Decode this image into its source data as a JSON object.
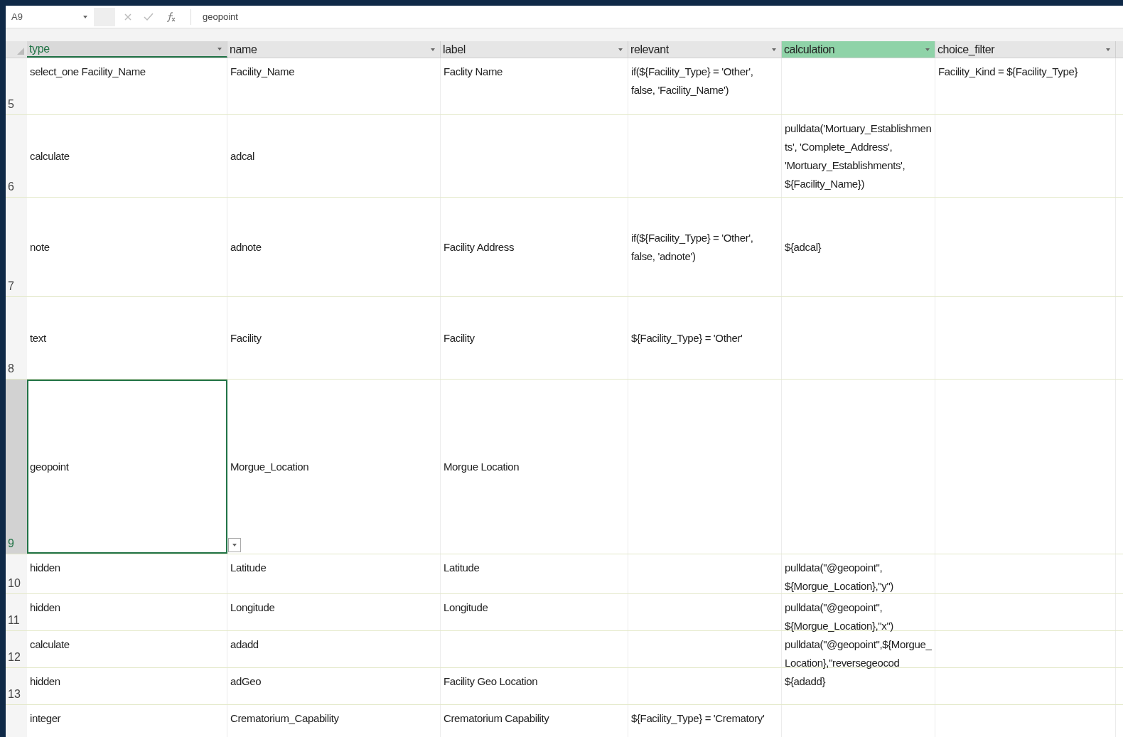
{
  "formula_bar": {
    "name_box": "A9",
    "formula": "geopoint"
  },
  "columns": [
    {
      "label": "type",
      "selected": true,
      "color": "#d9d9d9"
    },
    {
      "label": "name",
      "selected": false,
      "color": "#e6e6e6"
    },
    {
      "label": "label",
      "selected": false,
      "color": "#e6e6e6"
    },
    {
      "label": "relevant",
      "selected": false,
      "color": "#e6e6e6"
    },
    {
      "label": "calculation",
      "selected": false,
      "color": "#8fd3a8"
    },
    {
      "label": "choice_filter",
      "selected": false,
      "color": "#e6e6e6"
    }
  ],
  "rows": [
    {
      "number": "5",
      "selected": false,
      "cells": [
        "select_one Facility_Name",
        "Facility_Name",
        "Faclity Name",
        "if(${Facility_Type} = 'Other', false, 'Facility_Name')",
        "",
        "Facility_Kind = ${Facility_Type}"
      ]
    },
    {
      "number": "6",
      "selected": false,
      "cells": [
        "calculate",
        "adcal",
        "",
        "",
        "pulldata('Mortuary_Establishments', 'Complete_Address', 'Mortuary_Establishments', ${Facility_Name})",
        ""
      ]
    },
    {
      "number": "7",
      "selected": false,
      "cells": [
        "note",
        "adnote",
        "Facility Address",
        "if(${Facility_Type} = 'Other', false, 'adnote')",
        "${adcal}",
        ""
      ]
    },
    {
      "number": "8",
      "selected": false,
      "cells": [
        "text",
        "Facility",
        "Facility",
        "${Facility_Type} = 'Other'",
        "",
        ""
      ]
    },
    {
      "number": "9",
      "selected": true,
      "cells": [
        "geopoint",
        "Morgue_Location",
        "Morgue Location",
        "",
        "",
        ""
      ]
    },
    {
      "number": "10",
      "selected": false,
      "cells": [
        "hidden",
        "Latitude",
        "Latitude",
        "",
        "pulldata(\"@geopoint\", ${Morgue_Location},\"y\")",
        ""
      ]
    },
    {
      "number": "11",
      "selected": false,
      "cells": [
        "hidden",
        "Longitude",
        "Longitude",
        "",
        "pulldata(\"@geopoint\", ${Morgue_Location},\"x\")",
        ""
      ]
    },
    {
      "number": "12",
      "selected": false,
      "cells": [
        "calculate",
        "adadd",
        "",
        "",
        "pulldata(\"@geopoint\",${Morgue_Location},\"reversegeocod",
        ""
      ]
    },
    {
      "number": "13",
      "selected": false,
      "cells": [
        "hidden",
        "adGeo",
        "Facility Geo Location",
        "",
        "${adadd}",
        ""
      ]
    },
    {
      "selected": false,
      "cells": [
        "integer",
        "Crematorium_Capability",
        "Crematorium Capability",
        "${Facility_Type} = 'Crematory'",
        "",
        ""
      ]
    }
  ]
}
